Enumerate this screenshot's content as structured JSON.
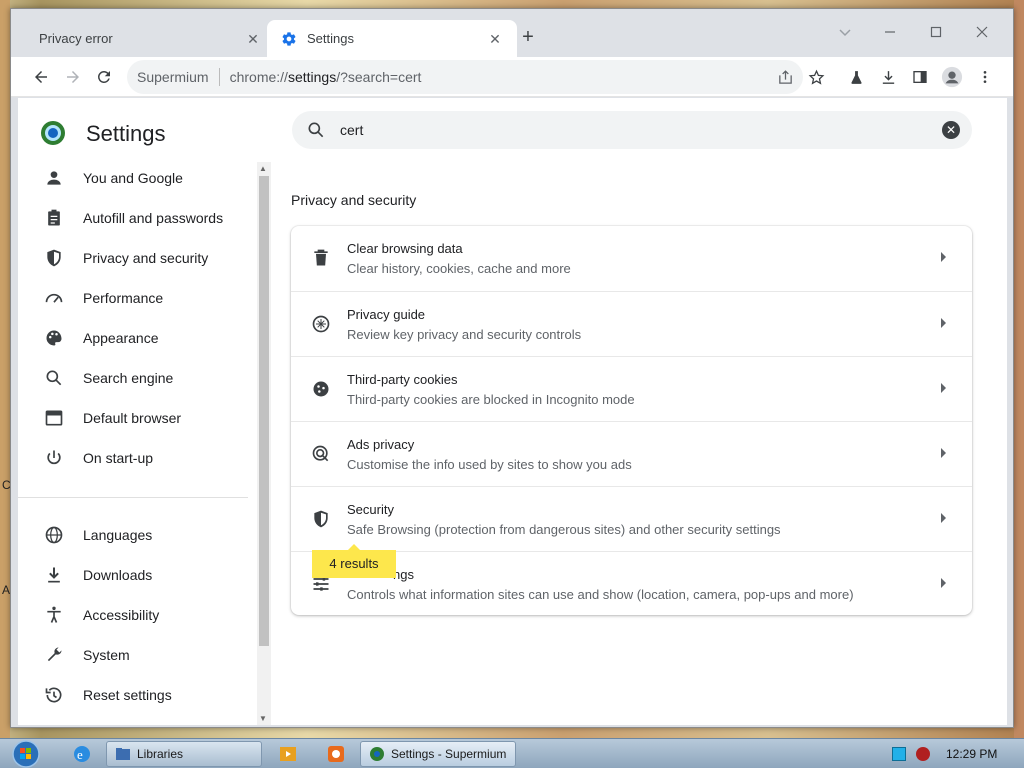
{
  "desktop": {
    "edge_letters": [
      "C",
      "A"
    ]
  },
  "browser": {
    "tabs": [
      {
        "label": "Privacy error",
        "active": false
      },
      {
        "label": "Settings",
        "active": true
      }
    ],
    "new_tab_symbol": "+",
    "window_controls": [
      "chevron-down-icon",
      "minimize-icon",
      "maximize-icon",
      "close-icon"
    ],
    "omnibox": {
      "site_name": "Supermium",
      "url_prefix": "chrome://",
      "url_host": "settings",
      "url_rest": "/?search=cert"
    },
    "toolbar_icons": [
      "share-icon",
      "star-icon",
      "labs-icon",
      "download-icon",
      "side-panel-icon",
      "profile-icon",
      "menu-icon"
    ]
  },
  "settings": {
    "title": "Settings",
    "search": {
      "value": "cert"
    },
    "nav_items": [
      {
        "label": "You and Google",
        "icon": "person-icon"
      },
      {
        "label": "Autofill and passwords",
        "icon": "clipboard-icon"
      },
      {
        "label": "Privacy and security",
        "icon": "shield-icon"
      },
      {
        "label": "Performance",
        "icon": "gauge-icon"
      },
      {
        "label": "Appearance",
        "icon": "palette-icon"
      },
      {
        "label": "Search engine",
        "icon": "search-icon"
      },
      {
        "label": "Default browser",
        "icon": "browser-icon"
      },
      {
        "label": "On start-up",
        "icon": "power-icon"
      },
      {
        "label": "Languages",
        "icon": "globe-icon"
      },
      {
        "label": "Downloads",
        "icon": "download-icon"
      },
      {
        "label": "Accessibility",
        "icon": "accessibility-icon"
      },
      {
        "label": "System",
        "icon": "wrench-icon"
      },
      {
        "label": "Reset settings",
        "icon": "history-icon"
      }
    ],
    "section_title": "Privacy and security",
    "rows": [
      {
        "title": "Clear browsing data",
        "subtitle": "Clear history, cookies, cache and more",
        "icon": "trash-icon"
      },
      {
        "title": "Privacy guide",
        "subtitle": "Review key privacy and security controls",
        "icon": "compass-icon"
      },
      {
        "title": "Third-party cookies",
        "subtitle": "Third-party cookies are blocked in Incognito mode",
        "icon": "cookie-icon"
      },
      {
        "title": "Ads privacy",
        "subtitle": "Customise the info used by sites to show you ads",
        "icon": "ads-icon"
      },
      {
        "title": "Security",
        "subtitle": "Safe Browsing (protection from dangerous sites) and other security settings",
        "icon": "shield-icon"
      },
      {
        "title": "ngs",
        "subtitle": "Controls what information sites can use and show (location, camera, pop-ups and more)",
        "icon": "sliders-icon"
      }
    ],
    "results_bubble": "4 results"
  },
  "taskbar": {
    "buttons": [
      {
        "label": "Libraries",
        "icon": "folder-icon"
      },
      {
        "label": "Settings - Supermium",
        "icon": "supermium-icon"
      }
    ],
    "clock": "12:29 PM"
  }
}
